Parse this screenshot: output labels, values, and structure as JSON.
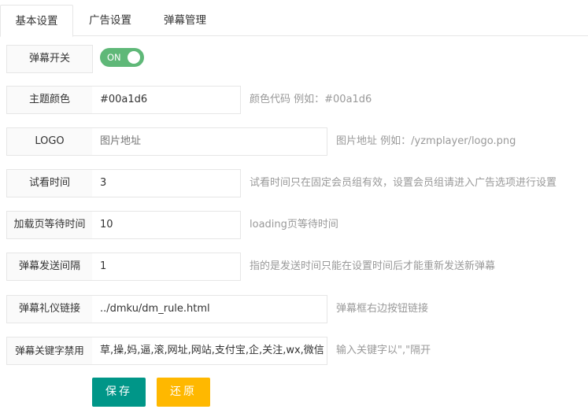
{
  "tabs": [
    "基本设置",
    "广告设置",
    "弹幕管理"
  ],
  "danmu_switch": {
    "label": "弹幕开关",
    "state": "ON"
  },
  "fields": [
    {
      "label": "主题颜色",
      "value": "#00a1d6",
      "hint": "颜色代码 例如：#00a1d6"
    },
    {
      "label": "LOGO",
      "placeholder": "图片地址",
      "hint": "图片地址 例如：/yzmplayer/logo.png"
    },
    {
      "label": "试看时间",
      "value": "3",
      "hint": "试看时间只在固定会员组有效，设置会员组请进入广告选项进行设置"
    },
    {
      "label": "加载页等待时间",
      "value": "10",
      "hint": "loading页等待时间"
    },
    {
      "label": "弹幕发送间隔",
      "value": "1",
      "hint": "指的是发送时间只能在设置时间后才能重新发送新弹幕"
    },
    {
      "label": "弹幕礼仪链接",
      "value": "../dmku/dm_rule.html",
      "hint": "弹幕框右边按钮链接"
    },
    {
      "label": "弹幕关键字禁用",
      "value": "草,操,妈,逼,滚,网址,网站,支付宝,企,关注,wx,微信",
      "hint": "输入关键字以\",\"隔开"
    }
  ],
  "buttons": {
    "save": "保存",
    "reset": "还原"
  },
  "colors": {
    "switch": "#5fb878",
    "save": "#009688",
    "reset": "#ffb800"
  }
}
